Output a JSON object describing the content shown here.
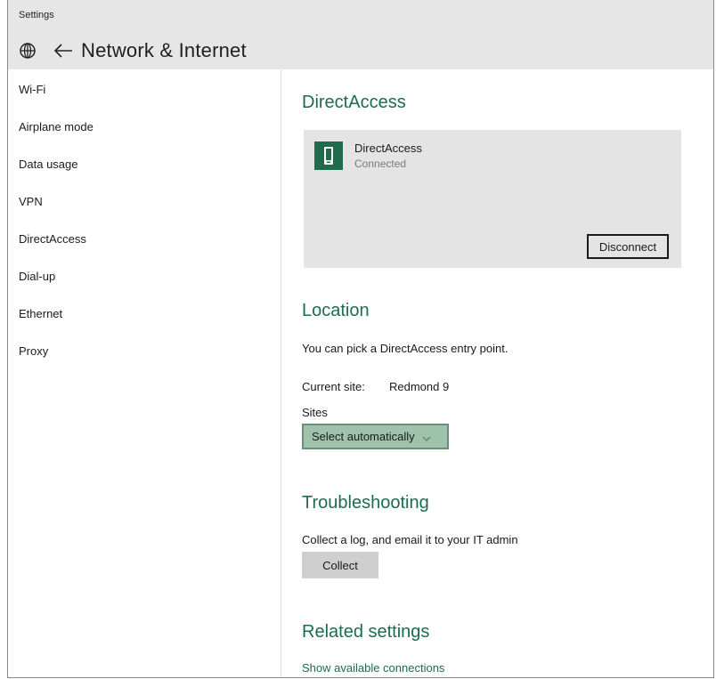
{
  "window": {
    "app_title": "Settings"
  },
  "header": {
    "title": "Network & Internet"
  },
  "sidebar": {
    "items": [
      {
        "label": "Wi-Fi"
      },
      {
        "label": "Airplane mode"
      },
      {
        "label": "Data usage"
      },
      {
        "label": "VPN"
      },
      {
        "label": "DirectAccess"
      },
      {
        "label": "Dial-up"
      },
      {
        "label": "Ethernet"
      },
      {
        "label": "Proxy"
      }
    ]
  },
  "main": {
    "directaccess": {
      "title": "DirectAccess",
      "connection_name": "DirectAccess",
      "connection_status": "Connected",
      "disconnect_label": "Disconnect"
    },
    "location": {
      "title": "Location",
      "description": "You can pick a DirectAccess entry point.",
      "current_site_label": "Current site:",
      "current_site_value": "Redmond 9",
      "sites_label": "Sites",
      "sites_selected": "Select automatically"
    },
    "troubleshooting": {
      "title": "Troubleshooting",
      "description": "Collect a log, and email it to your IT admin",
      "collect_label": "Collect"
    },
    "related": {
      "title": "Related settings",
      "link_label": "Show available connections"
    }
  },
  "colors": {
    "accent": "#1c6b52",
    "icon_tile": "#1f6b4c",
    "select_bg": "#9fc2ad",
    "card_bg": "#e4e4e4",
    "titlebar_bg": "#e6e6e6"
  },
  "icons": {
    "header_icon": "globe-icon",
    "back_icon": "back-arrow-icon",
    "connection_icon": "phone-device-icon",
    "dropdown_icon": "chevron-down-icon"
  }
}
